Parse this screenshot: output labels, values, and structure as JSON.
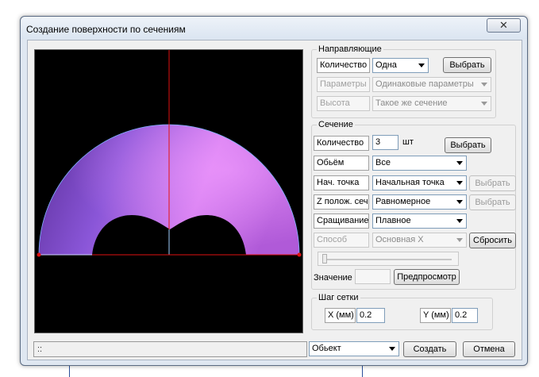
{
  "window": {
    "title": "Создание поверхности по сечениям",
    "close_symbol": "✕"
  },
  "status": {
    "text": "::"
  },
  "guides": {
    "legend": "Направляющие",
    "count_label": "Количество",
    "count_value": "Одна",
    "count_button": "Выбрать",
    "params_label": "Параметры",
    "params_value": "Одинаковые параметры",
    "height_label": "Высота",
    "height_value": "Такое же сечение"
  },
  "section": {
    "legend": "Сечение",
    "count_label": "Количество",
    "count_value": "3",
    "count_unit": "шт",
    "count_button": "Выбрать",
    "volume_label": "Обьём",
    "volume_value": "Все",
    "start_label": "Нач. точка",
    "start_value": "Начальная точка",
    "start_button": "Выбрать",
    "zpos_label": "Z полож. сеч.",
    "zpos_value": "Равномерное",
    "zpos_button": "Выбрать",
    "join_label": "Сращивание",
    "join_value": "Плавное",
    "method_label": "Способ",
    "method_value": "Основная X",
    "reset_button": "Сбросить",
    "value_label": "Значение",
    "value_input": "",
    "preview_button": "Предпросмотр"
  },
  "grid": {
    "legend": "Шаг сетки",
    "x_label": "X (мм)",
    "x_value": "0.2",
    "y_label": "Y (мм)",
    "y_value": "0.2"
  },
  "footer": {
    "object_value": "Обьект",
    "create_button": "Создать",
    "cancel_button": "Отмена"
  },
  "colors": {
    "surface_dark": "#6a3aa8",
    "surface_light": "#e28cf5",
    "axis": "#e01010",
    "viewport_bg": "#000000"
  }
}
